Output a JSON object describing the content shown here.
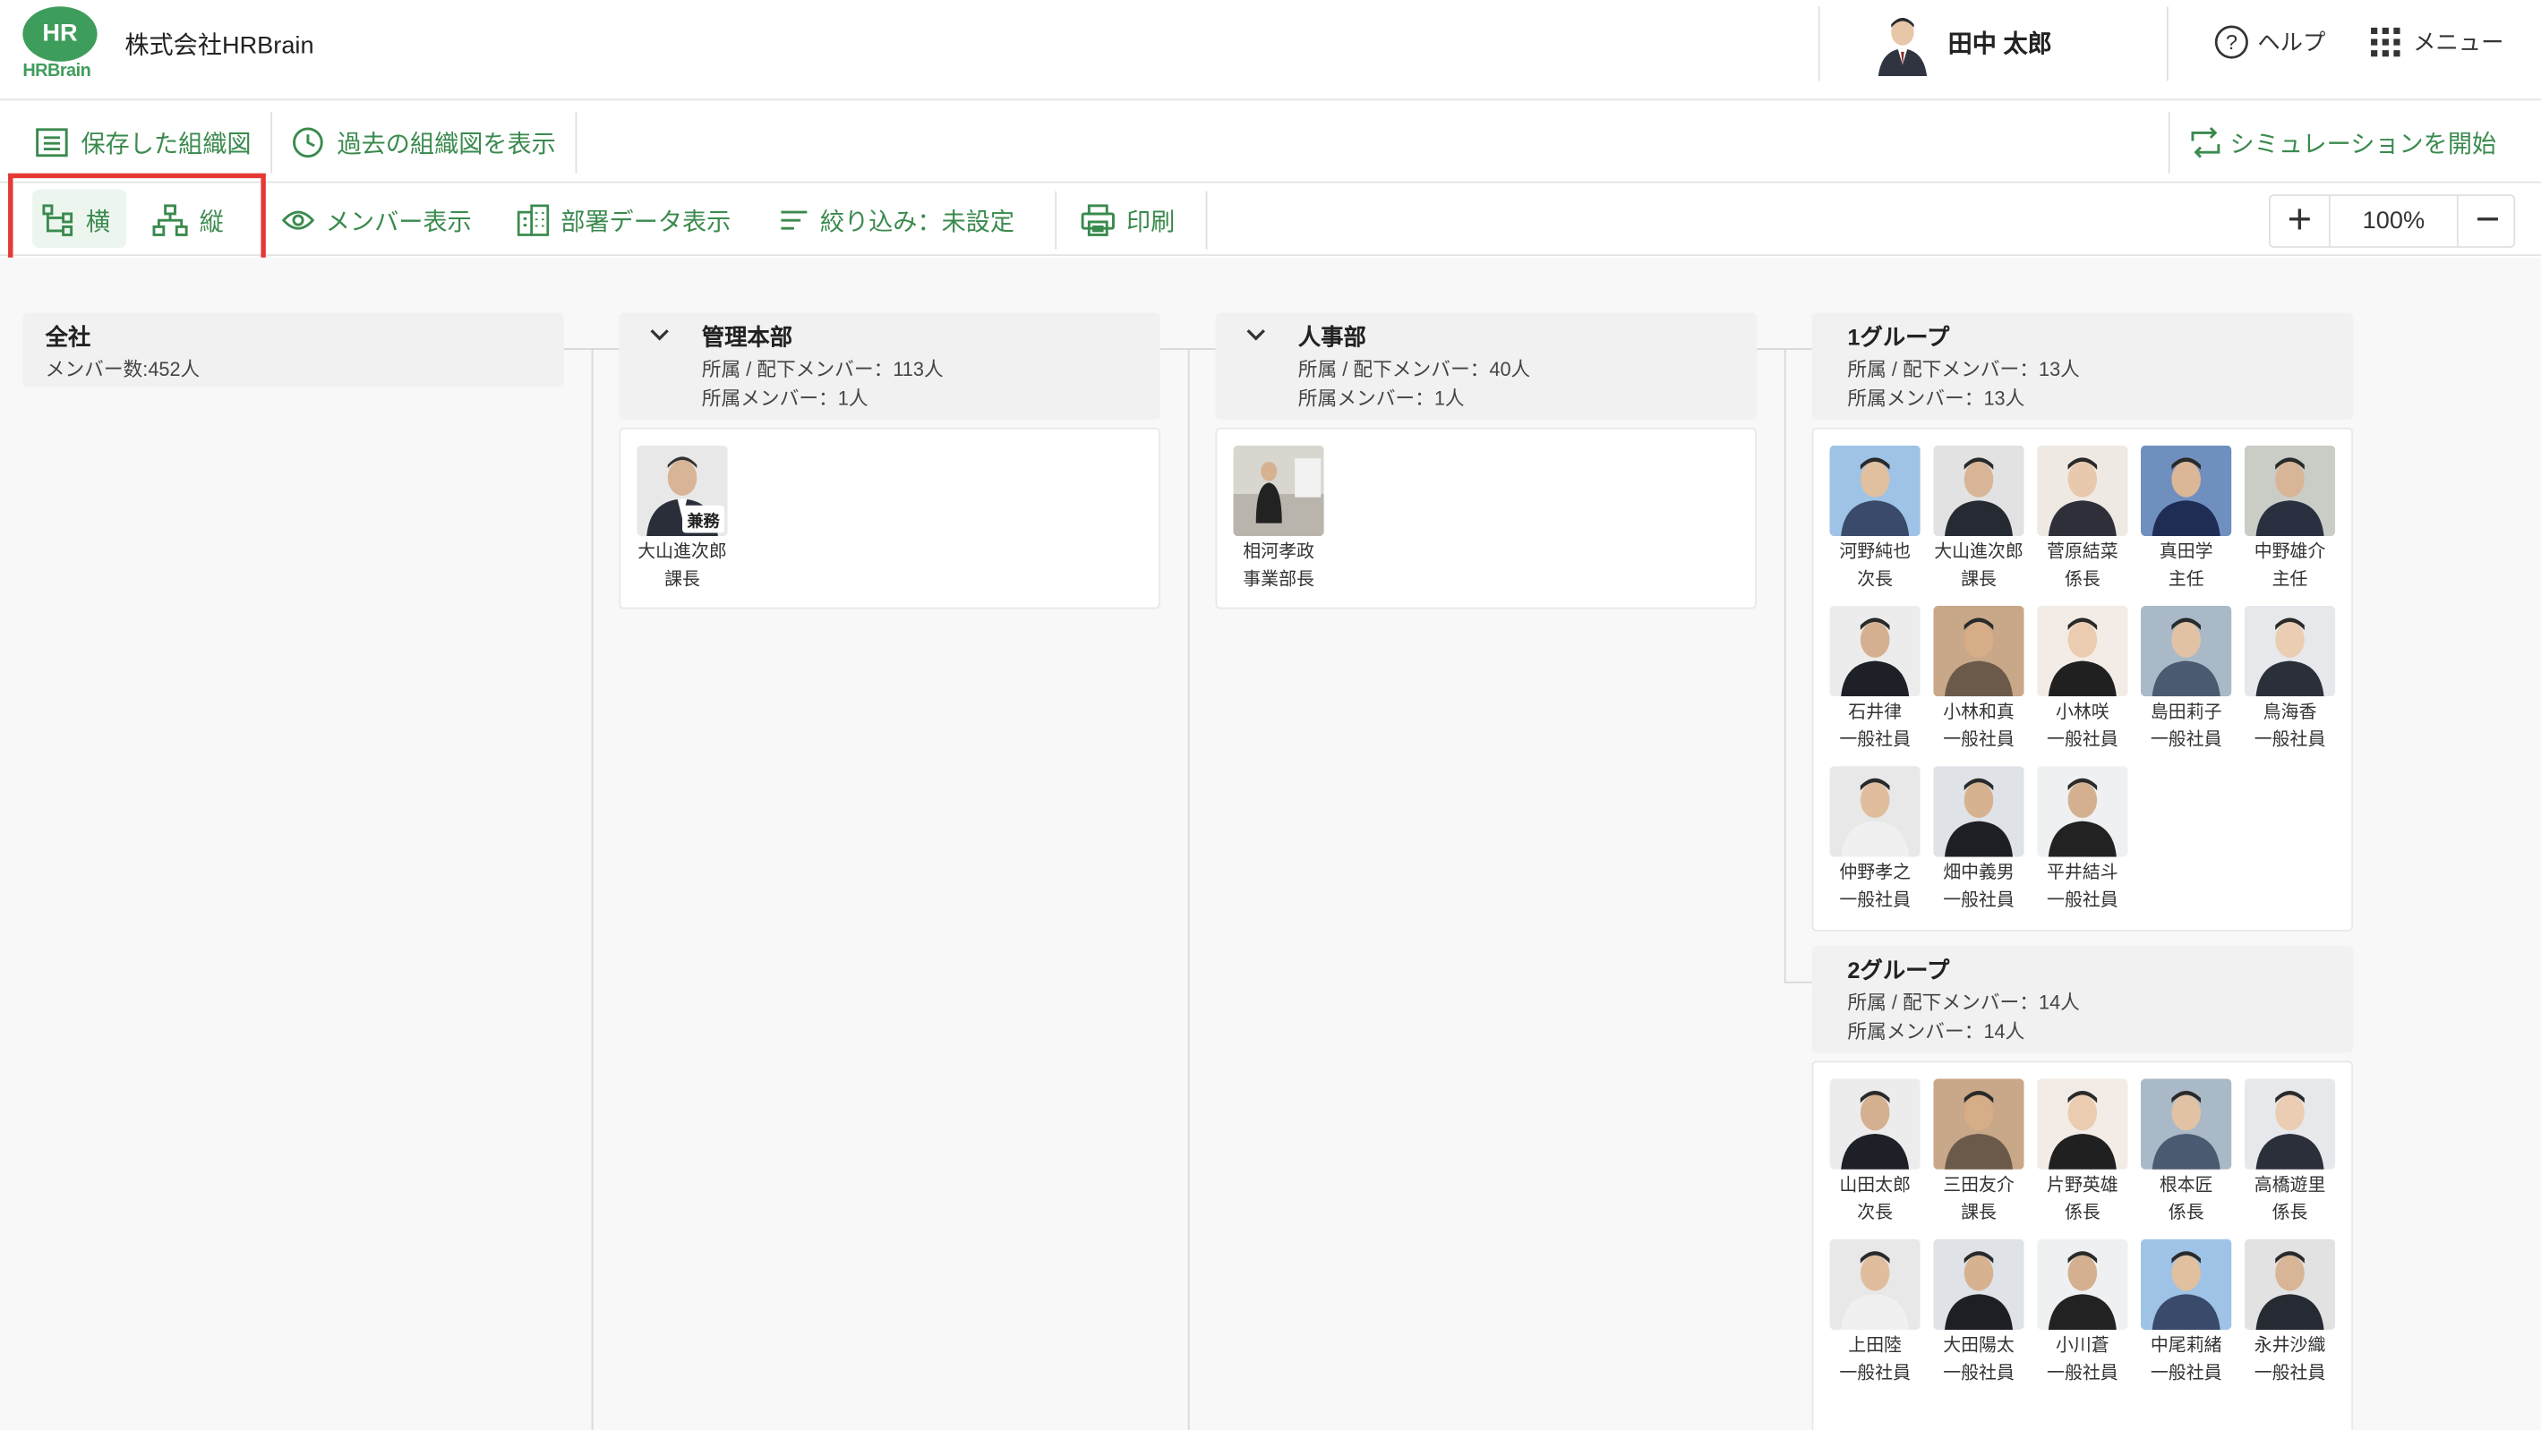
{
  "header": {
    "logo_main": "HR",
    "logo_sub": "HRBrain",
    "company": "株式会社HRBrain",
    "user_name": "田中 太郎",
    "help_label": "ヘルプ",
    "menu_label": "メニュー"
  },
  "toolbar1": {
    "saved_chart": "保存した組織図",
    "past_chart": "過去の組織図を表示",
    "simulation": "シミュレーションを開始"
  },
  "toolbar2": {
    "horizontal": "横",
    "vertical": "縦",
    "member_view": "メンバー表示",
    "dept_data": "部署データ表示",
    "filter": "絞り込み：未設定",
    "print": "印刷",
    "zoom_plus": "+",
    "zoom": "100%",
    "zoom_minus": "−"
  },
  "colors": {
    "accent": "#3a8a4e",
    "highlight_border": "#e53935",
    "logo": "#3f9d5c"
  },
  "org": {
    "company": {
      "name": "全社",
      "members": "メンバー数:452人"
    },
    "admin": {
      "name": "管理本部",
      "sub_total": "所属 / 配下メンバー：113人",
      "direct": "所属メンバー：1人",
      "members": [
        {
          "name": "大山進次郎",
          "title": "課長",
          "badge": "兼務"
        }
      ]
    },
    "hr": {
      "name": "人事部",
      "sub_total": "所属 / 配下メンバー：40人",
      "direct": "所属メンバー：1人",
      "members": [
        {
          "name": "相河孝政",
          "title": "事業部長"
        }
      ]
    },
    "group1": {
      "name": "1グループ",
      "sub_total": "所属 / 配下メンバー：13人",
      "direct": "所属メンバー：13人",
      "members": [
        {
          "name": "河野純也",
          "title": "次長"
        },
        {
          "name": "大山進次郎",
          "title": "課長"
        },
        {
          "name": "菅原結菜",
          "title": "係長"
        },
        {
          "name": "真田学",
          "title": "主任"
        },
        {
          "name": "中野雄介",
          "title": "主任"
        },
        {
          "name": "石井律",
          "title": "一般社員"
        },
        {
          "name": "小林和真",
          "title": "一般社員"
        },
        {
          "name": "小林咲",
          "title": "一般社員"
        },
        {
          "name": "島田莉子",
          "title": "一般社員"
        },
        {
          "name": "鳥海香",
          "title": "一般社員"
        },
        {
          "name": "仲野孝之",
          "title": "一般社員"
        },
        {
          "name": "畑中義男",
          "title": "一般社員"
        },
        {
          "name": "平井結斗",
          "title": "一般社員"
        }
      ]
    },
    "group2": {
      "name": "2グループ",
      "sub_total": "所属 / 配下メンバー：14人",
      "direct": "所属メンバー：14人",
      "members": [
        {
          "name": "山田太郎",
          "title": "次長"
        },
        {
          "name": "三田友介",
          "title": "課長"
        },
        {
          "name": "片野英雄",
          "title": "係長"
        },
        {
          "name": "根本匠",
          "title": "係長"
        },
        {
          "name": "高橋遊里",
          "title": "係長"
        },
        {
          "name": "上田陸",
          "title": "一般社員"
        },
        {
          "name": "大田陽太",
          "title": "一般社員"
        },
        {
          "name": "小川蒼",
          "title": "一般社員"
        },
        {
          "name": "中尾莉緒",
          "title": "一般社員"
        },
        {
          "name": "永井沙織",
          "title": "一般社員"
        }
      ]
    }
  }
}
